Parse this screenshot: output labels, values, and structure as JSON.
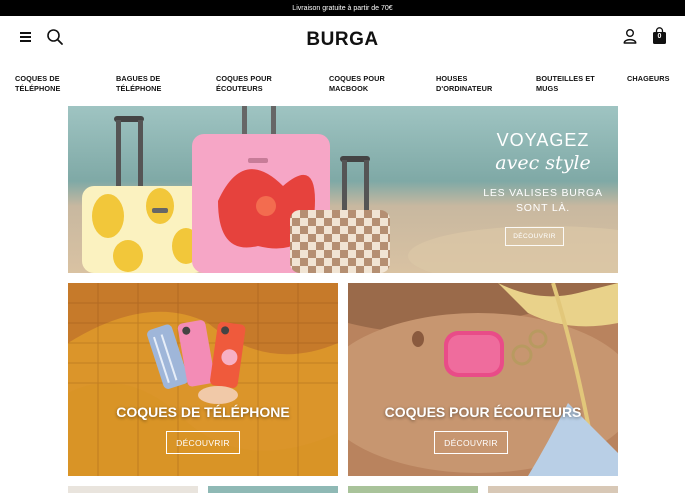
{
  "promo": {
    "text": "Livraison gratuite à partir de 70€"
  },
  "header": {
    "logo": "BURGA",
    "cart_count": "0",
    "icons": [
      "menu-icon",
      "search-icon",
      "user-icon",
      "shopping-bag-icon"
    ]
  },
  "nav": {
    "items": [
      {
        "label": "COQUES DE TÉLÉPHONE"
      },
      {
        "label": "BAGUES DE TÉLÉPHONE"
      },
      {
        "label": "COQUES POUR ÉCOUTEURS"
      },
      {
        "label": "COQUES POUR MACBOOK"
      },
      {
        "label": "HOUSES D'ORDINATEUR"
      },
      {
        "label": "BOUTEILLES ET MUGS"
      },
      {
        "label": "CHAGEURS"
      }
    ]
  },
  "hero": {
    "title": "VOYAGEZ",
    "script": "avec style",
    "subtitle_line1": "LES VALISES BURGA",
    "subtitle_line2": "SONT LÀ.",
    "button": "DÉCOUVRIR"
  },
  "tiles": [
    {
      "title": "COQUES DE TÉLÉPHONE",
      "button": "DÉCOUVRIR"
    },
    {
      "title": "COQUES POUR ÉCOUTEURS",
      "button": "DÉCOUVRIR"
    }
  ],
  "colors": {
    "promo_bg": "#000000",
    "text": "#111111",
    "accent_pink": "#f06aa0",
    "sea": "#8fb6b0"
  }
}
